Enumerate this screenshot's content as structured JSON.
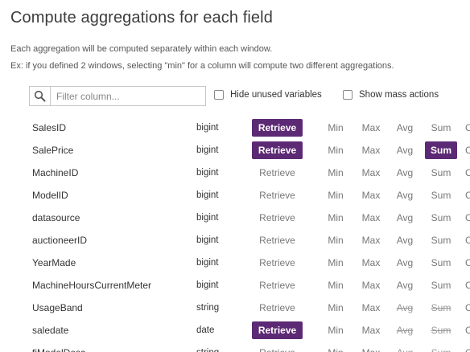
{
  "header": {
    "title": "Compute aggregations for each field",
    "desc1": "Each aggregation will be computed separately within each window.",
    "desc2": "Ex: if you defined 2 windows, selecting \"min\" for a column will compute two different aggregations."
  },
  "toolbar": {
    "filter_placeholder": "Filter column...",
    "filter_value": "",
    "hide_unused_label": "Hide unused variables",
    "hide_unused_checked": false,
    "mass_actions_label": "Show mass actions",
    "mass_actions_checked": false
  },
  "aggregation_labels": {
    "retrieve": "Retrieve",
    "min": "Min",
    "max": "Max",
    "avg": "Avg",
    "sum": "Sum",
    "count_cut": "C"
  },
  "colors": {
    "accent": "#5c2a74",
    "inactive_text": "#777777"
  },
  "rows": [
    {
      "name": "SalesID",
      "type": "bigint",
      "retrieve": true,
      "min": false,
      "max": false,
      "avg": false,
      "sum": false,
      "avg_disabled": false,
      "sum_disabled": false
    },
    {
      "name": "SalePrice",
      "type": "bigint",
      "retrieve": true,
      "min": false,
      "max": false,
      "avg": false,
      "sum": true,
      "avg_disabled": false,
      "sum_disabled": false
    },
    {
      "name": "MachineID",
      "type": "bigint",
      "retrieve": false,
      "min": false,
      "max": false,
      "avg": false,
      "sum": false,
      "avg_disabled": false,
      "sum_disabled": false
    },
    {
      "name": "ModelID",
      "type": "bigint",
      "retrieve": false,
      "min": false,
      "max": false,
      "avg": false,
      "sum": false,
      "avg_disabled": false,
      "sum_disabled": false
    },
    {
      "name": "datasource",
      "type": "bigint",
      "retrieve": false,
      "min": false,
      "max": false,
      "avg": false,
      "sum": false,
      "avg_disabled": false,
      "sum_disabled": false
    },
    {
      "name": "auctioneerID",
      "type": "bigint",
      "retrieve": false,
      "min": false,
      "max": false,
      "avg": false,
      "sum": false,
      "avg_disabled": false,
      "sum_disabled": false
    },
    {
      "name": "YearMade",
      "type": "bigint",
      "retrieve": false,
      "min": false,
      "max": false,
      "avg": false,
      "sum": false,
      "avg_disabled": false,
      "sum_disabled": false
    },
    {
      "name": "MachineHoursCurrentMeter",
      "type": "bigint",
      "retrieve": false,
      "min": false,
      "max": false,
      "avg": false,
      "sum": false,
      "avg_disabled": false,
      "sum_disabled": false
    },
    {
      "name": "UsageBand",
      "type": "string",
      "retrieve": false,
      "min": false,
      "max": false,
      "avg": false,
      "sum": false,
      "avg_disabled": true,
      "sum_disabled": true
    },
    {
      "name": "saledate",
      "type": "date",
      "retrieve": true,
      "min": false,
      "max": false,
      "avg": false,
      "sum": false,
      "avg_disabled": true,
      "sum_disabled": true
    },
    {
      "name": "fiModelDesc",
      "type": "string",
      "retrieve": false,
      "min": false,
      "max": false,
      "avg": false,
      "sum": false,
      "avg_disabled": true,
      "sum_disabled": true
    }
  ]
}
